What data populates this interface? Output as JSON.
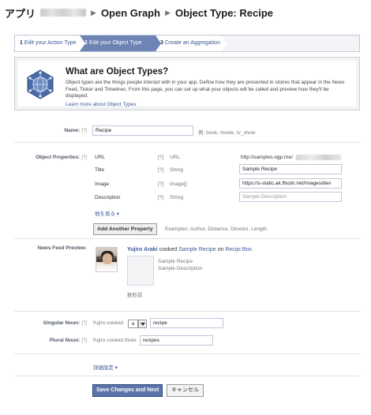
{
  "breadcrumb": {
    "items": [
      "アプリ",
      "Open Graph",
      "Object Type: Recipe"
    ]
  },
  "wizard": {
    "steps": [
      {
        "num": "1",
        "label": "Edit your Action Type"
      },
      {
        "num": "2",
        "label": "Edit your Object Type"
      },
      {
        "num": "3",
        "label": "Create an Aggregation"
      }
    ],
    "active_step": 2
  },
  "info": {
    "title": "What are Object Types?",
    "body": "Object types are the things people interact with in your app. Define how they are presented in stories that appear in the News Feed, Ticker and Timelines. From this page, you can set up what your objects will be called and preview how they'll be displayed.",
    "link": "Learn more about Object Types",
    "icon": "globe-network-icon"
  },
  "form": {
    "help_mark": "[?]",
    "name": {
      "label": "Name:",
      "value": "Recipe",
      "example": "例: book, movie, tv_show"
    },
    "object_properties": {
      "label": "Object Properties:",
      "rows": [
        {
          "name": "URL",
          "type": "URL",
          "value": "http://samples.ogp.me/",
          "is_input": false
        },
        {
          "name": "Title",
          "type": "String",
          "value": "Sample Recipe",
          "is_input": true
        },
        {
          "name": "Image",
          "type": "Image[]",
          "value": "https://s-static.ak.fbcdn.net/images/dev",
          "is_input": true
        },
        {
          "name": "Description",
          "type": "String",
          "value": "",
          "placeholder": "Sample Description",
          "is_input": true
        }
      ],
      "see_more": "他を見る",
      "add_button": "Add Another Property",
      "examples": "Examples: Author, Distance, Director, Length"
    },
    "preview": {
      "label": "News Feed Preview:",
      "user": "Yujiro Araki",
      "verb": "cooked",
      "object": "Sample Recipe",
      "prep": "on",
      "app": "Recipi Box.",
      "attachment_title": "Sample Recipe",
      "attachment_desc": "Sample Description",
      "time": "数秒前"
    },
    "singular": {
      "label": "Singular Noun:",
      "prefix": "Yujiro cooked",
      "article": "a",
      "value": "recipe"
    },
    "plural": {
      "label": "Plural Noun:",
      "prefix": "Yujiro cooked three",
      "value": "recipes"
    },
    "advanced_link": "詳細設定",
    "save_button": "Save Changes and Next",
    "cancel_button": "キャンセル"
  },
  "colors": {
    "link": "#3b5998",
    "active_step": "#6d84b4",
    "primary_button": "#5b74a8"
  }
}
